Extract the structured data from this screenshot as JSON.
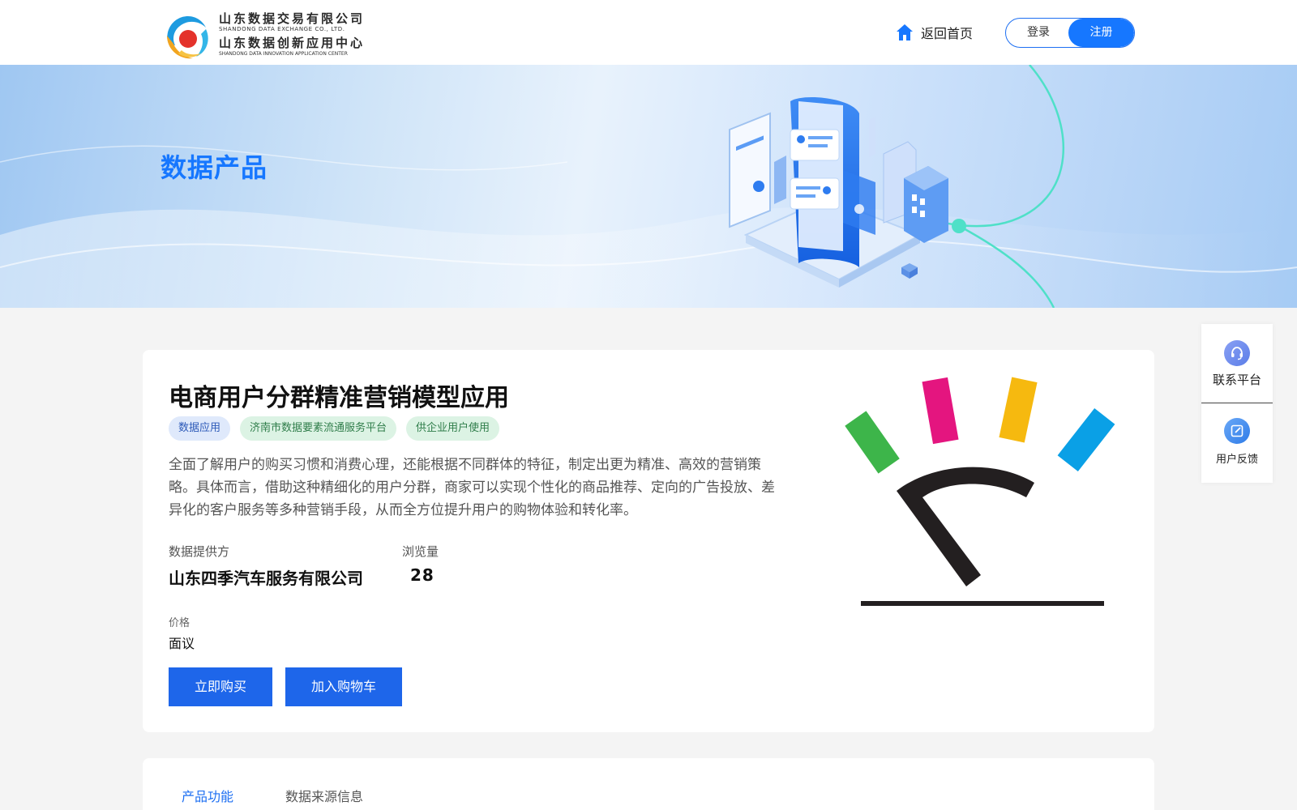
{
  "header": {
    "logo": {
      "line1_cn": "山东数据交易有限公司",
      "line1_en": "SHANDONG DATA EXCHANGE CO., LTD.",
      "line2_cn": "山东数据创新应用中心",
      "line2_en": "SHANDONG DATA INNOVATION APPLICATION CENTER"
    },
    "home_label": "返回首页",
    "login_label": "登录",
    "register_label": "注册"
  },
  "banner": {
    "title": "数据产品"
  },
  "product": {
    "title": "电商用户分群精准营销模型应用",
    "tags": [
      "数据应用",
      "济南市数据要素流通服务平台",
      "供企业用户使用"
    ],
    "description": "全面了解用户的购买习惯和消费心理，还能根据不同群体的特征，制定出更为精准、高效的营销策略。具体而言，借助这种精细化的用户分群，商家可以实现个性化的商品推荐、定向的广告投放、差异化的客户服务等多种营销手段，从而全方位提升用户的购物体验和转化率。",
    "provider_label": "数据提供方",
    "provider_value": "山东四季汽车服务有限公司",
    "views_label": "浏览量",
    "views_value": "28",
    "price_label": "价格",
    "price_value": "面议",
    "buy_label": "立即购买",
    "cart_label": "加入购物车"
  },
  "tabs": [
    "产品功能",
    "数据来源信息"
  ],
  "side": {
    "contact_label": "联系平台",
    "feedback_label": "用户反馈"
  },
  "colors": {
    "accent": "#1677ff",
    "button": "#1e66ea"
  },
  "icons": [
    "home-icon",
    "headset-icon",
    "edit-icon"
  ]
}
